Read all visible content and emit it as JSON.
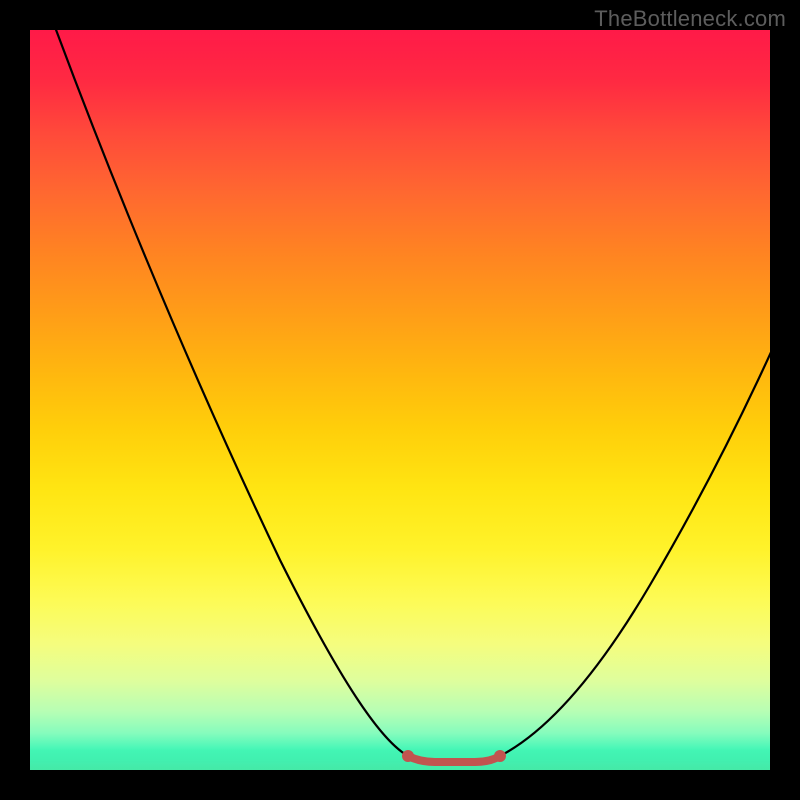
{
  "watermark": {
    "text": "TheBottleneck.com"
  },
  "colors": {
    "frame": "#000000",
    "curve": "#000000",
    "highlight": "#c1544f",
    "gradient_top": "#ff1a48",
    "gradient_mid": "#ffe512",
    "gradient_bottom": "#0adf90"
  },
  "chart_data": {
    "type": "line",
    "title": "",
    "xlabel": "",
    "ylabel": "",
    "xlim": [
      0,
      100
    ],
    "ylim": [
      0,
      100
    ],
    "grid": false,
    "legend": false,
    "background": "vertical-gradient red→yellow→green",
    "notes": "V-shaped curve; y-value represents bottleneck severity (high=red, low=green). Flat minimum region highlighted.",
    "x": [
      0,
      3,
      6,
      10,
      15,
      20,
      25,
      30,
      35,
      40,
      45,
      50,
      52,
      55,
      58,
      60,
      63,
      66,
      70,
      75,
      80,
      85,
      90,
      95,
      100
    ],
    "values": [
      108,
      100,
      92,
      82,
      70,
      58,
      47,
      37,
      27,
      18,
      10,
      4,
      2,
      1,
      1,
      1,
      2,
      4,
      8,
      14,
      22,
      31,
      41,
      52,
      63
    ],
    "highlight_region": {
      "x_start": 50,
      "x_end": 63,
      "y": 1
    }
  }
}
